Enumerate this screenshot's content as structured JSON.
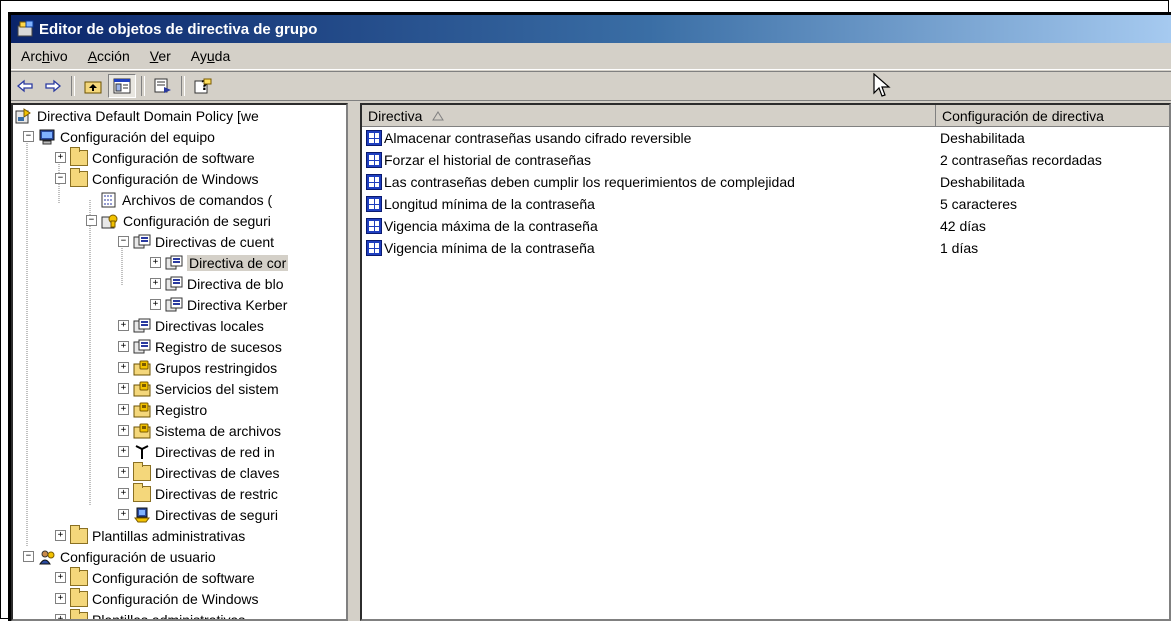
{
  "window": {
    "title": "Editor de objetos de directiva de grupo"
  },
  "menu": [
    {
      "label": "Archivo"
    },
    {
      "label": "Acción"
    },
    {
      "label": "Ver"
    },
    {
      "label": "Ayuda"
    }
  ],
  "toolbar": {
    "buttons": [
      "back-arrow-icon",
      "forward-arrow-icon",
      "up-folder-icon",
      "show-hide-tree-icon",
      "export-list-icon",
      "help-icon"
    ]
  },
  "tree": [
    {
      "label": "Directiva Default Domain Policy [we",
      "icon": "policy-icon"
    },
    {
      "label": "Configuración del equipo",
      "icon": "computer-icon"
    },
    {
      "label": "Configuración de software",
      "icon": "folder-icon"
    },
    {
      "label": "Configuración de Windows",
      "icon": "folder-icon"
    },
    {
      "label": "Archivos de comandos (",
      "icon": "script-icon"
    },
    {
      "label": "Configuración de seguri",
      "icon": "security-icon"
    },
    {
      "label": "Directivas de cuent",
      "icon": "policy-folder-icon"
    },
    {
      "label": "Directiva de cor",
      "icon": "policy-folder-icon"
    },
    {
      "label": "Directiva de blo",
      "icon": "policy-folder-icon"
    },
    {
      "label": "Directiva Kerber",
      "icon": "policy-folder-icon"
    },
    {
      "label": "Directivas locales",
      "icon": "policy-folder-icon"
    },
    {
      "label": "Registro de sucesos",
      "icon": "policy-folder-icon"
    },
    {
      "label": "Grupos restringidos",
      "icon": "lock-folder-icon"
    },
    {
      "label": "Servicios del sistem",
      "icon": "lock-folder-icon"
    },
    {
      "label": "Registro",
      "icon": "lock-folder-icon"
    },
    {
      "label": "Sistema de archivos",
      "icon": "lock-folder-icon"
    },
    {
      "label": "Directivas de red in",
      "icon": "antenna-icon"
    },
    {
      "label": "Directivas de claves",
      "icon": "folder-icon"
    },
    {
      "label": "Directivas de restric",
      "icon": "folder-icon"
    },
    {
      "label": "Directivas de seguri",
      "icon": "ip-security-icon"
    },
    {
      "label": "Plantillas administrativas",
      "icon": "folder-icon"
    },
    {
      "label": "Configuración de usuario",
      "icon": "user-icon"
    },
    {
      "label": "Configuración de software",
      "icon": "folder-icon"
    },
    {
      "label": "Configuración de Windows",
      "icon": "folder-icon"
    },
    {
      "label": "Plantillas administrativas",
      "icon": "folder-icon"
    }
  ],
  "list": {
    "columns": [
      "Directiva",
      "Configuración de directiva"
    ],
    "rows": [
      {
        "name": "Almacenar contraseñas usando cifrado reversible",
        "value": "Deshabilitada"
      },
      {
        "name": "Forzar el historial de contraseñas",
        "value": "2 contraseñas recordadas"
      },
      {
        "name": "Las contraseñas deben cumplir los requerimientos de complejidad",
        "value": "Deshabilitada"
      },
      {
        "name": "Longitud mínima de la contraseña",
        "value": "5 caracteres"
      },
      {
        "name": "Vigencia máxima de la contraseña",
        "value": "42 días"
      },
      {
        "name": "Vigencia mínima de la contraseña",
        "value": "1 días"
      }
    ]
  }
}
